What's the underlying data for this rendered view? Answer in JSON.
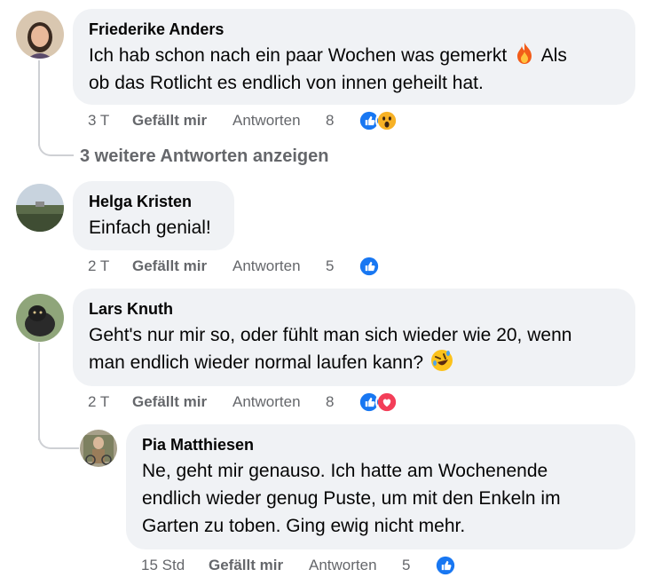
{
  "comments": [
    {
      "author": "Friederike Anders",
      "text": "Ich hab schon nach ein paar Wochen was gemerkt 🔥 Als ob das Rotlicht es endlich von innen geheilt hat.",
      "text_part1": "Ich hab schon nach ein paar Wochen was gemerkt",
      "text_part2": "Als",
      "text_line2": "ob das Rotlicht es endlich von innen geheilt hat.",
      "emoji": "fire",
      "time": "3 T",
      "like_label": "Gefällt mir",
      "reply_label": "Antworten",
      "reaction_count": "8",
      "reactions": [
        "like-icon",
        "wow-icon"
      ]
    },
    {
      "author": "Helga Kristen",
      "text": "Einfach genial!",
      "time": "2 T",
      "like_label": "Gefällt mir",
      "reply_label": "Antworten",
      "reaction_count": "5",
      "reactions": [
        "like-icon"
      ]
    },
    {
      "author": "Lars Knuth",
      "text_line1": "Geht's nur mir so, oder fühlt man sich wieder wie 20, wenn",
      "text_line2": "man endlich wieder normal laufen kann?",
      "emoji": "rolling-on-floor-laughing",
      "time": "2 T",
      "like_label": "Gefällt mir",
      "reply_label": "Antworten",
      "reaction_count": "8",
      "reactions": [
        "like-icon",
        "love-icon"
      ]
    }
  ],
  "more_replies_label": "3 weitere Antworten anzeigen",
  "reply": {
    "author": "Pia Matthiesen",
    "text_line1": "Ne, geht mir genauso. Ich hatte am Wochenende",
    "text_line2": "endlich wieder genug Puste, um mit den Enkeln im",
    "text_line3": "Garten zu toben. Ging ewig nicht mehr.",
    "time": "15 Std",
    "like_label": "Gefällt mir",
    "reply_label": "Antworten",
    "reaction_count": "5",
    "reactions": [
      "like-icon"
    ]
  },
  "colors": {
    "like": "#1877f2",
    "love": "#f33e58",
    "wow": "#f7b125",
    "bubble": "#f0f2f5",
    "meta": "#65676b"
  }
}
